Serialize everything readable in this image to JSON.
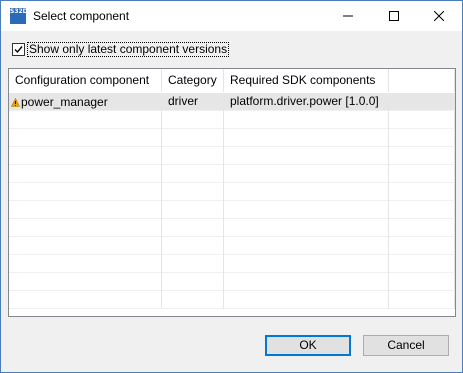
{
  "window": {
    "title": "Select component",
    "icon": "s32ds-app-icon",
    "icon_text": "S32DS"
  },
  "options": {
    "show_latest_label": "Show only latest component versions",
    "show_latest_checked": true
  },
  "table": {
    "columns": [
      "Configuration component",
      "Category",
      "Required SDK components",
      ""
    ],
    "rows": [
      {
        "component": "power_manager",
        "category": "driver",
        "sdk": "platform.driver.power [1.0.0]",
        "extra": "",
        "icon": "warning-icon",
        "selected": true
      }
    ]
  },
  "buttons": {
    "ok": "OK",
    "cancel": "Cancel"
  },
  "colors": {
    "accent": "#0078d7",
    "selection": "#e6e6e6",
    "warning": "#e8a400"
  }
}
